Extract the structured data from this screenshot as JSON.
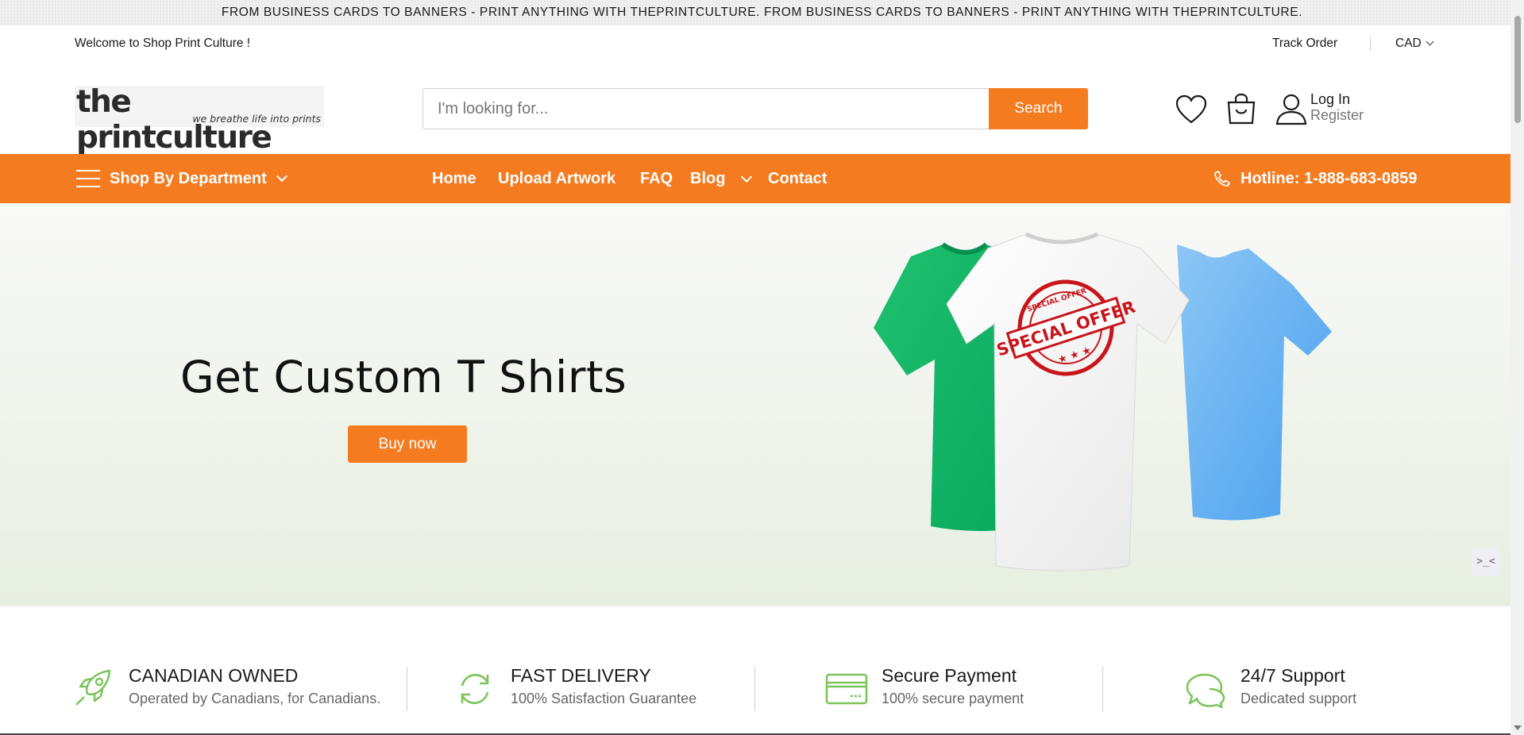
{
  "announcement": "FROM BUSINESS CARDS TO BANNERS - PRINT ANYTHING WITH THEPRINTCULTURE. FROM BUSINESS CARDS TO BANNERS - PRINT ANYTHING WITH THEPRINTCULTURE.",
  "topbar": {
    "welcome": "Welcome to Shop Print Culture !",
    "track_order": "Track Order",
    "currency": "CAD"
  },
  "header": {
    "logo_text": "the printculture",
    "logo_tagline": "we breathe life into prints",
    "search_placeholder": "I'm looking for...",
    "search_button": "Search",
    "login": "Log In",
    "register": "Register",
    "icons": [
      "heart-icon",
      "shopping-bag-icon",
      "user-icon"
    ]
  },
  "nav": {
    "department": "Shop By Department",
    "items": [
      "Home",
      "Upload Artwork",
      "FAQ",
      "Blog",
      "Contact"
    ],
    "hotline": "Hotline: 1-888-683-0859"
  },
  "hero": {
    "title": "Get Custom T Shirts",
    "button": "Buy now",
    "stamp_text": "SPECIAL OFFER",
    "stamp_small": "SPECIAL OFFER"
  },
  "features": [
    {
      "icon": "rocket-icon",
      "title": "CANADIAN OWNED",
      "subtitle": "Operated by Canadians, for Canadians."
    },
    {
      "icon": "refresh-icon",
      "title": "FAST DELIVERY",
      "subtitle": "100% Satisfaction Guarantee"
    },
    {
      "icon": "credit-card-icon",
      "title": "Secure Payment",
      "subtitle": "100% secure payment"
    },
    {
      "icon": "chat-icon",
      "title": "24/7 Support",
      "subtitle": "Dedicated support"
    }
  ],
  "colors": {
    "brand_orange": "#f47b20",
    "feature_green": "#7cc35a",
    "stamp_red": "#c8151b"
  }
}
